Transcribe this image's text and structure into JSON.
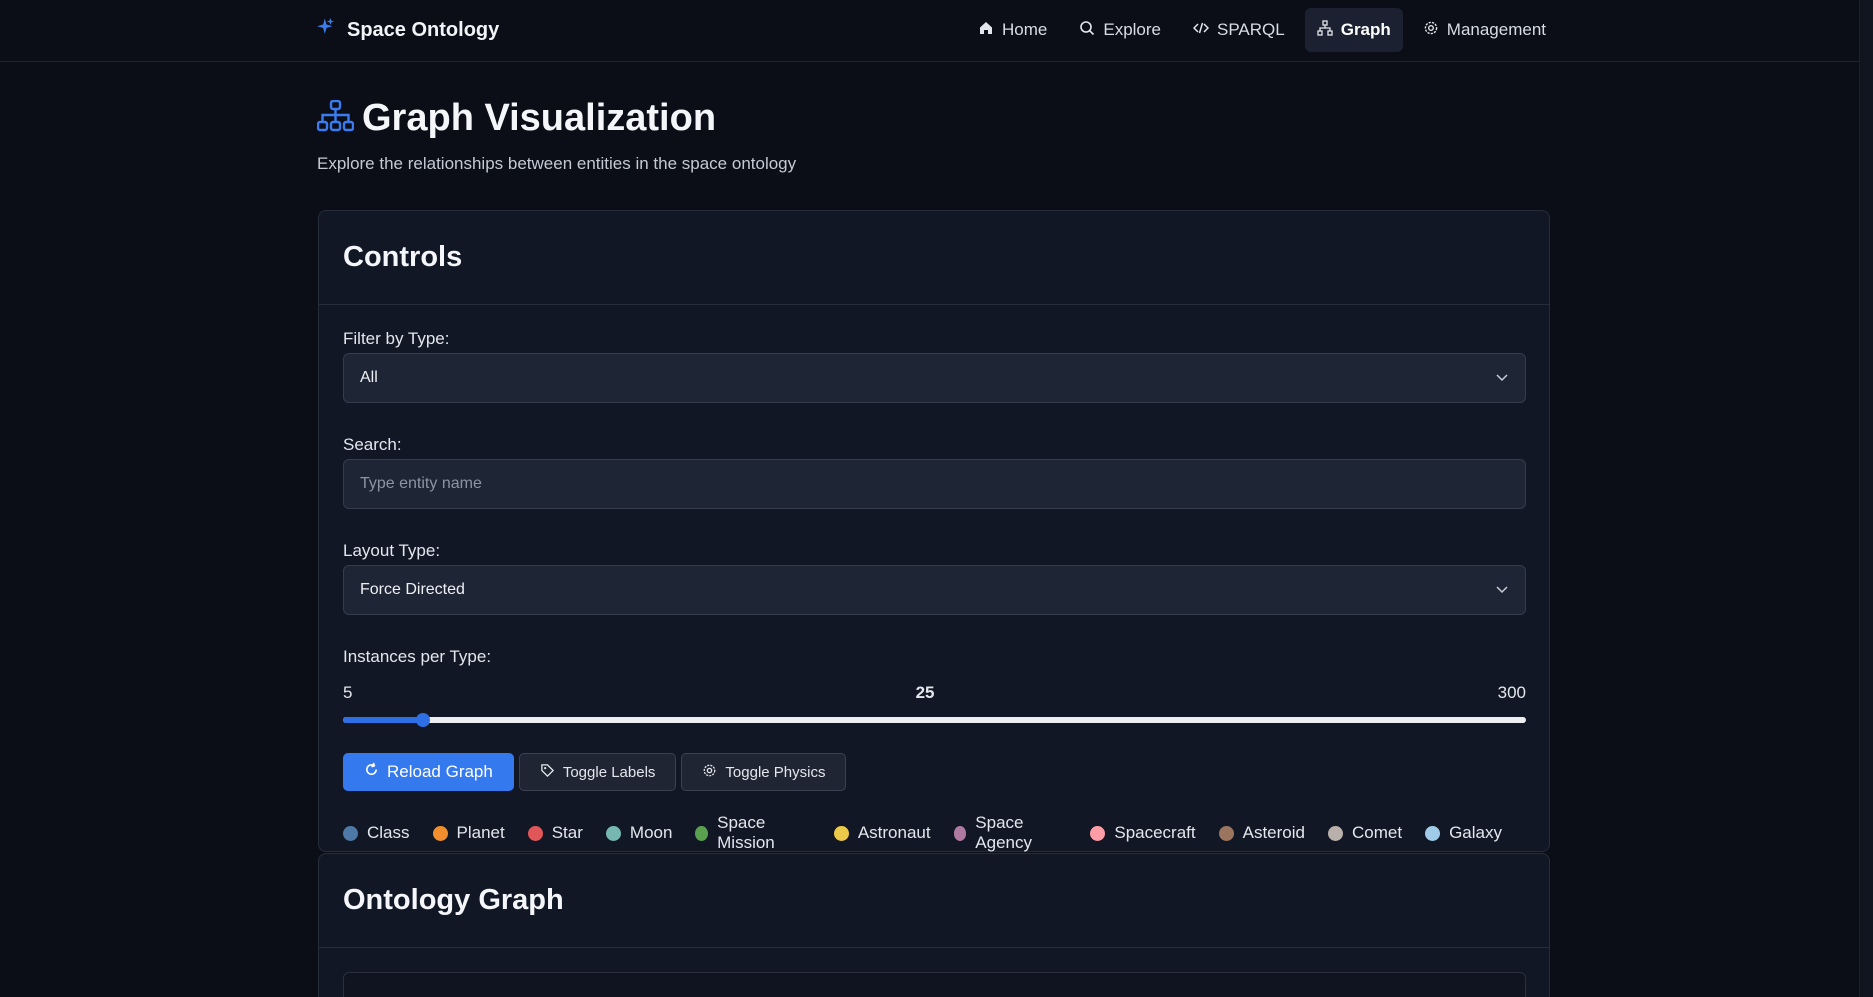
{
  "brand": {
    "name": "Space Ontology",
    "icon": "sparkles-icon"
  },
  "nav": [
    {
      "label": "Home",
      "icon": "home-icon",
      "active": false
    },
    {
      "label": "Explore",
      "icon": "search-icon",
      "active": false
    },
    {
      "label": "SPARQL",
      "icon": "code-icon",
      "active": false
    },
    {
      "label": "Graph",
      "icon": "network-icon",
      "active": true
    },
    {
      "label": "Management",
      "icon": "gear-icon",
      "active": false
    }
  ],
  "header": {
    "title": "Graph Visualization",
    "subtitle": "Explore the relationships between entities in the space ontology",
    "icon": "network-icon"
  },
  "controls": {
    "title": "Controls",
    "filter": {
      "label": "Filter by Type:",
      "value": "All"
    },
    "search": {
      "label": "Search:",
      "placeholder": "Type entity name",
      "value": ""
    },
    "layout": {
      "label": "Layout Type:",
      "value": "Force Directed"
    },
    "instances": {
      "label": "Instances per Type:",
      "min": "5",
      "max": "300",
      "value": "25"
    },
    "buttons": {
      "reload": "Reload Graph",
      "labels": "Toggle Labels",
      "physics": "Toggle Physics"
    }
  },
  "legend": [
    {
      "label": "Class",
      "color": "#4e79a7"
    },
    {
      "label": "Planet",
      "color": "#f28e2c"
    },
    {
      "label": "Star",
      "color": "#e15759"
    },
    {
      "label": "Moon",
      "color": "#76b7b2"
    },
    {
      "label": "Space Mission",
      "color": "#59a14f"
    },
    {
      "label": "Astronaut",
      "color": "#edc949"
    },
    {
      "label": "Space Agency",
      "color": "#af7aa1"
    },
    {
      "label": "Spacecraft",
      "color": "#ff9da7"
    },
    {
      "label": "Asteroid",
      "color": "#9c755f"
    },
    {
      "label": "Comet",
      "color": "#bab0ab"
    },
    {
      "label": "Galaxy",
      "color": "#a0cbe8"
    }
  ],
  "graph": {
    "title": "Ontology Graph"
  },
  "colors": {
    "accent": "#3479ee",
    "background": "#0b0e16",
    "card": "#121725"
  }
}
